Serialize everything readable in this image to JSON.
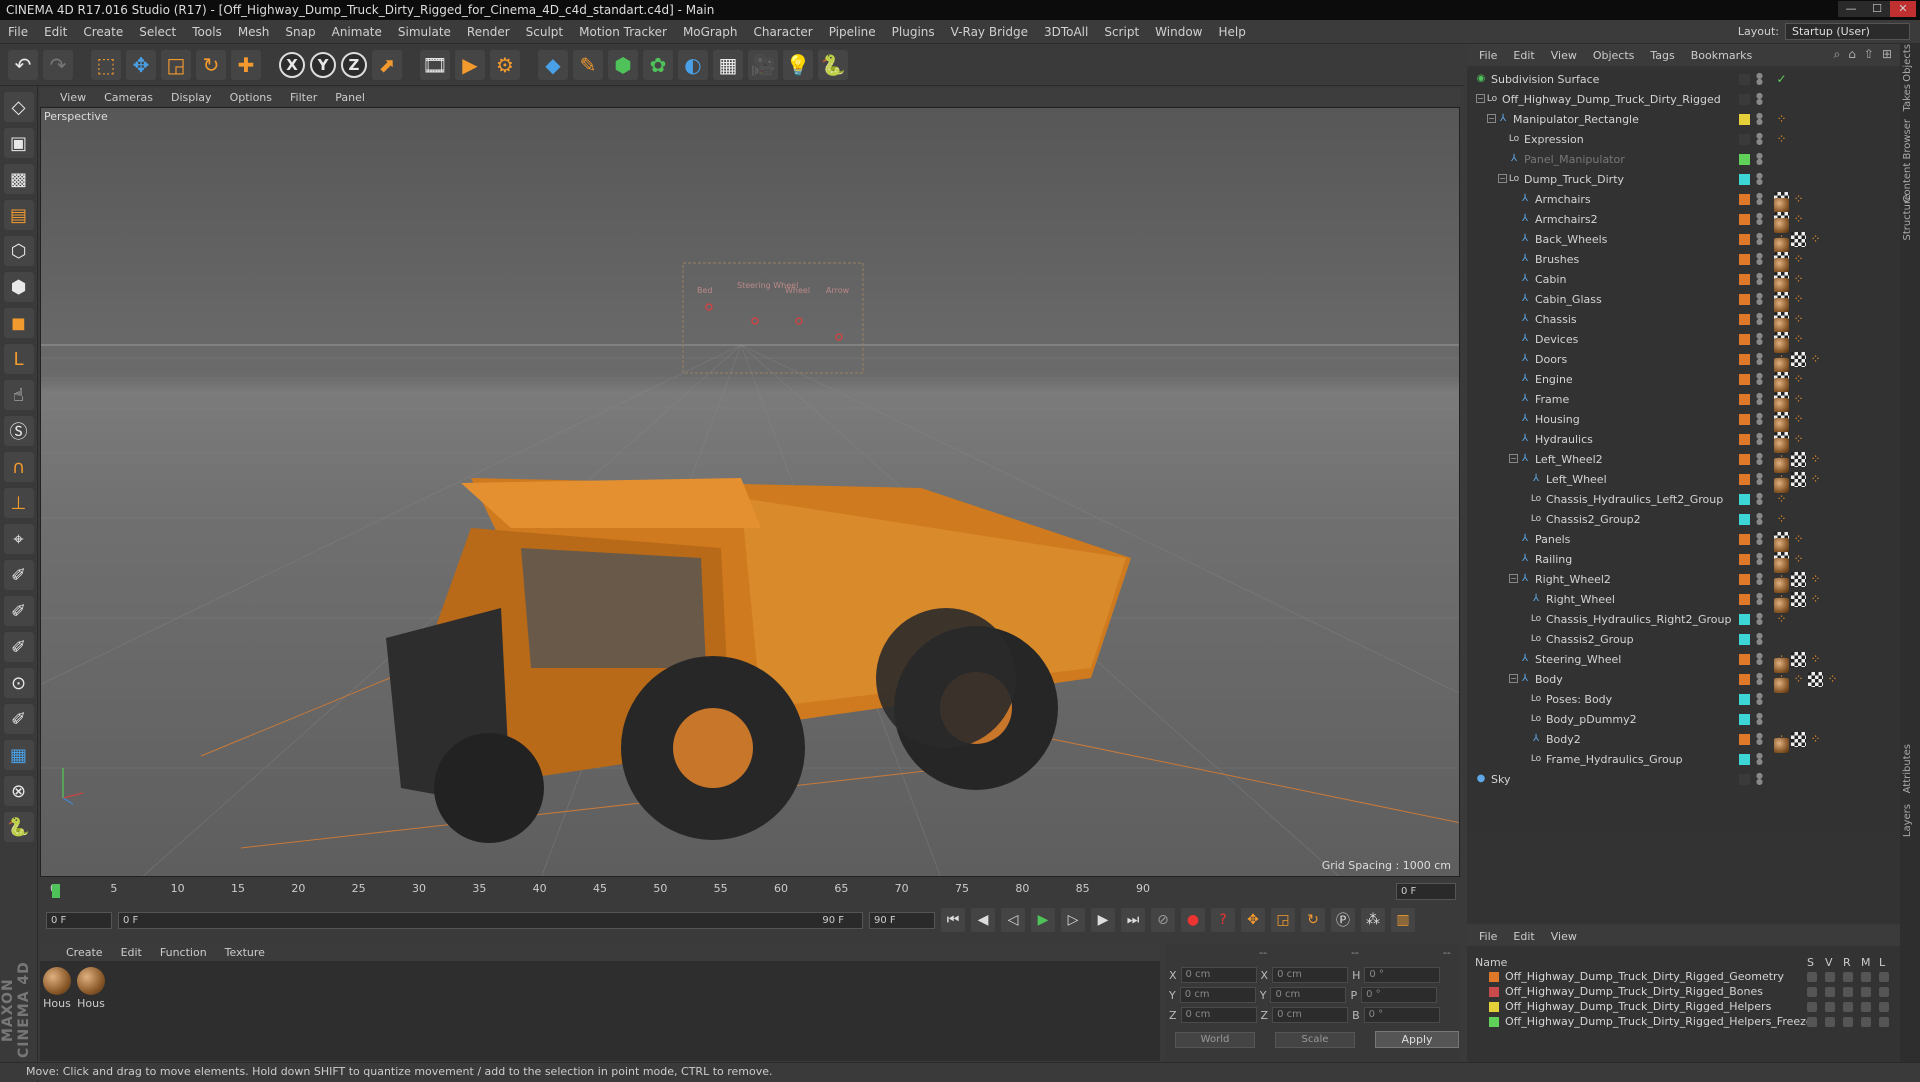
{
  "window": {
    "title": "CINEMA 4D R17.016 Studio (R17) - [Off_Highway_Dump_Truck_Dirty_Rigged_for_Cinema_4D_c4d_standart.c4d] - Main",
    "minimize": "—",
    "maximize": "☐",
    "close": "✕"
  },
  "menubar": [
    "File",
    "Edit",
    "Create",
    "Select",
    "Tools",
    "Mesh",
    "Snap",
    "Animate",
    "Simulate",
    "Render",
    "Sculpt",
    "Motion Tracker",
    "MoGraph",
    "Character",
    "Pipeline",
    "Plugins",
    "V-Ray Bridge",
    "3DToAll",
    "Script",
    "Window",
    "Help"
  ],
  "layout": {
    "label": "Layout:",
    "value": "Startup (User)"
  },
  "toolbar_icons": [
    "undo-icon",
    "redo-icon",
    "live-selection-icon",
    "move-icon",
    "scale-icon",
    "rotate-icon",
    "add-object-icon",
    "x-axis-icon",
    "y-axis-icon",
    "z-axis-icon",
    "world-coordinates-icon",
    "render-view-icon",
    "render-to-picture-viewer-icon",
    "render-settings-icon",
    "cube-icon",
    "pen-spline-icon",
    "subdivision-icon",
    "mograph-cloner-icon",
    "deformer-icon",
    "floor-icon",
    "camera-icon",
    "light-icon",
    "python-icon"
  ],
  "axes": {
    "x": "X",
    "y": "Y",
    "z": "Z"
  },
  "viewport": {
    "menu": [
      "View",
      "Cameras",
      "Display",
      "Options",
      "Filter",
      "Panel"
    ],
    "label": "Perspective",
    "grid_spacing": "Grid Spacing : 1000 cm"
  },
  "timeline": {
    "ticks": [
      "0",
      "5",
      "10",
      "15",
      "20",
      "25",
      "30",
      "35",
      "40",
      "45",
      "50",
      "55",
      "60",
      "65",
      "70",
      "75",
      "80",
      "85",
      "90"
    ],
    "current_frame": "0 F",
    "start_frame": "0 F",
    "slider_start": "0 F",
    "slider_end": "90 F",
    "end_frame": "90 F"
  },
  "materials": {
    "menu": [
      "Create",
      "Edit",
      "Function",
      "Texture"
    ],
    "items": [
      "Hous",
      "Hous"
    ]
  },
  "coords": {
    "headers": [
      "--",
      "--",
      "--"
    ],
    "rows": [
      {
        "a": "X",
        "av": "0 cm",
        "b": "X",
        "bv": "0 cm",
        "c": "H",
        "cv": "0 °"
      },
      {
        "a": "Y",
        "av": "0 cm",
        "b": "Y",
        "bv": "0 cm",
        "c": "P",
        "cv": "0 °"
      },
      {
        "a": "Z",
        "av": "0 cm",
        "b": "Z",
        "bv": "0 cm",
        "c": "B",
        "cv": "0 °"
      }
    ],
    "mode1": "World",
    "mode2": "Scale",
    "apply": "Apply"
  },
  "status": "Move: Click and drag to move elements. Hold down SHIFT to quantize movement / add to the selection in point mode, CTRL to remove.",
  "objects_panel": {
    "menu": [
      "File",
      "Edit",
      "View",
      "Objects",
      "Tags",
      "Bookmarks"
    ],
    "items": [
      {
        "name": "Subdivision Surface",
        "depth": 0,
        "icon": "subdivision-icon",
        "color": "#3a3a3a",
        "tags": [
          "check"
        ]
      },
      {
        "name": "Off_Highway_Dump_Truck_Dirty_Rigged",
        "depth": 1,
        "icon": "null-icon",
        "color": "#3a3a3a",
        "tags": []
      },
      {
        "name": "Manipulator_Rectangle",
        "depth": 2,
        "icon": "spline-icon",
        "color": "#e6d03a",
        "tags": [
          "pt"
        ]
      },
      {
        "name": "Expression",
        "depth": 3,
        "icon": "null-icon",
        "color": "#3a3a3a",
        "tags": [
          "pt"
        ]
      },
      {
        "name": "Panel_Manipulator",
        "depth": 3,
        "icon": "spline-icon",
        "color": "#5fd05a",
        "tags": []
      },
      {
        "name": "Dump_Truck_Dirty",
        "depth": 3,
        "icon": "null-icon",
        "color": "#3cd6d6",
        "tags": []
      },
      {
        "name": "Armchairs",
        "depth": 4,
        "icon": "joint-icon",
        "color": "#e0782a",
        "tags": [
          "mat",
          "chk",
          "pt"
        ]
      },
      {
        "name": "Armchairs2",
        "depth": 4,
        "icon": "joint-icon",
        "color": "#e0782a",
        "tags": [
          "mat",
          "chk",
          "pt"
        ]
      },
      {
        "name": "Back_Wheels",
        "depth": 4,
        "icon": "joint-icon",
        "color": "#e0782a",
        "tags": [
          "pt",
          "mat",
          "chk",
          "pt"
        ]
      },
      {
        "name": "Brushes",
        "depth": 4,
        "icon": "joint-icon",
        "color": "#e0782a",
        "tags": [
          "mat",
          "chk",
          "pt"
        ]
      },
      {
        "name": "Cabin",
        "depth": 4,
        "icon": "joint-icon",
        "color": "#e0782a",
        "tags": [
          "mat",
          "chk",
          "pt"
        ]
      },
      {
        "name": "Cabin_Glass",
        "depth": 4,
        "icon": "joint-icon",
        "color": "#e0782a",
        "tags": [
          "mat",
          "chk",
          "pt"
        ]
      },
      {
        "name": "Chassis",
        "depth": 4,
        "icon": "joint-icon",
        "color": "#e0782a",
        "tags": [
          "mat",
          "chk",
          "pt"
        ]
      },
      {
        "name": "Devices",
        "depth": 4,
        "icon": "joint-icon",
        "color": "#e0782a",
        "tags": [
          "mat",
          "chk",
          "pt"
        ]
      },
      {
        "name": "Doors",
        "depth": 4,
        "icon": "joint-icon",
        "color": "#e0782a",
        "tags": [
          "pt",
          "mat",
          "chk",
          "pt"
        ]
      },
      {
        "name": "Engine",
        "depth": 4,
        "icon": "joint-icon",
        "color": "#e0782a",
        "tags": [
          "mat",
          "chk",
          "pt"
        ]
      },
      {
        "name": "Frame",
        "depth": 4,
        "icon": "joint-icon",
        "color": "#e0782a",
        "tags": [
          "mat",
          "chk",
          "pt"
        ]
      },
      {
        "name": "Housing",
        "depth": 4,
        "icon": "joint-icon",
        "color": "#e0782a",
        "tags": [
          "mat",
          "chk",
          "pt"
        ]
      },
      {
        "name": "Hydraulics",
        "depth": 4,
        "icon": "joint-icon",
        "color": "#e0782a",
        "tags": [
          "mat",
          "chk",
          "pt"
        ]
      },
      {
        "name": "Left_Wheel2",
        "depth": 4,
        "icon": "joint-icon",
        "color": "#e0782a",
        "tags": [
          "pt",
          "mat",
          "chk",
          "pt"
        ]
      },
      {
        "name": "Left_Wheel",
        "depth": 5,
        "icon": "joint-icon",
        "color": "#e0782a",
        "tags": [
          "pt",
          "mat",
          "chk",
          "pt"
        ]
      },
      {
        "name": "Chassis_Hydraulics_Left2_Group",
        "depth": 5,
        "icon": "null-icon",
        "color": "#3cd6d6",
        "tags": [
          "pt"
        ]
      },
      {
        "name": "Chassis2_Group2",
        "depth": 5,
        "icon": "null-icon",
        "color": "#3cd6d6",
        "tags": [
          "pt"
        ]
      },
      {
        "name": "Panels",
        "depth": 4,
        "icon": "joint-icon",
        "color": "#e0782a",
        "tags": [
          "mat",
          "chk",
          "pt"
        ]
      },
      {
        "name": "Railing",
        "depth": 4,
        "icon": "joint-icon",
        "color": "#e0782a",
        "tags": [
          "mat",
          "chk",
          "pt"
        ]
      },
      {
        "name": "Right_Wheel2",
        "depth": 4,
        "icon": "joint-icon",
        "color": "#e0782a",
        "tags": [
          "pt",
          "mat",
          "chk",
          "pt"
        ]
      },
      {
        "name": "Right_Wheel",
        "depth": 5,
        "icon": "joint-icon",
        "color": "#e0782a",
        "tags": [
          "pt",
          "mat",
          "chk",
          "pt"
        ]
      },
      {
        "name": "Chassis_Hydraulics_Right2_Group",
        "depth": 5,
        "icon": "null-icon",
        "color": "#3cd6d6",
        "tags": [
          "pt"
        ]
      },
      {
        "name": "Chassis2_Group",
        "depth": 5,
        "icon": "null-icon",
        "color": "#3cd6d6",
        "tags": []
      },
      {
        "name": "Steering_Wheel",
        "depth": 4,
        "icon": "joint-icon",
        "color": "#e0782a",
        "tags": [
          "pt",
          "mat",
          "chk",
          "pt"
        ]
      },
      {
        "name": "Body",
        "depth": 4,
        "icon": "joint-icon",
        "color": "#e0782a",
        "tags": [
          "pt",
          "pt",
          "mat",
          "chk",
          "pt"
        ]
      },
      {
        "name": "Poses: Body",
        "depth": 5,
        "icon": "null-icon",
        "color": "#3cd6d6",
        "tags": []
      },
      {
        "name": "Body_pDummy2",
        "depth": 5,
        "icon": "null-icon",
        "color": "#3cd6d6",
        "tags": []
      },
      {
        "name": "Body2",
        "depth": 5,
        "icon": "joint-icon",
        "color": "#e0782a",
        "tags": [
          "pt",
          "mat",
          "chk",
          "pt"
        ]
      },
      {
        "name": "Frame_Hydraulics_Group",
        "depth": 5,
        "icon": "null-icon",
        "color": "#3cd6d6",
        "tags": []
      },
      {
        "name": "Sky",
        "depth": 0,
        "icon": "sky-icon",
        "color": "#3a3a3a",
        "tags": []
      }
    ]
  },
  "layers_panel": {
    "menu": [
      "File",
      "Edit",
      "View"
    ],
    "header": {
      "name": "Name",
      "cols": [
        "S",
        "V",
        "R",
        "M",
        "L"
      ]
    },
    "items": [
      {
        "name": "Off_Highway_Dump_Truck_Dirty_Rigged_Geometry",
        "color": "#e0782a"
      },
      {
        "name": "Off_Highway_Dump_Truck_Dirty_Rigged_Bones",
        "color": "#c84a4a"
      },
      {
        "name": "Off_Highway_Dump_Truck_Dirty_Rigged_Helpers",
        "color": "#e6d03a"
      },
      {
        "name": "Off_Highway_Dump_Truck_Dirty_Rigged_Helpers_Freeze",
        "color": "#5fd05a"
      }
    ]
  },
  "right_tabs": [
    "Objects",
    "Takes",
    "Content Browser",
    "Structure",
    "Attributes",
    "Layers"
  ],
  "manipulator_labels": [
    "Bed",
    "Steering Wheel",
    "Wheel",
    "Arrow"
  ]
}
